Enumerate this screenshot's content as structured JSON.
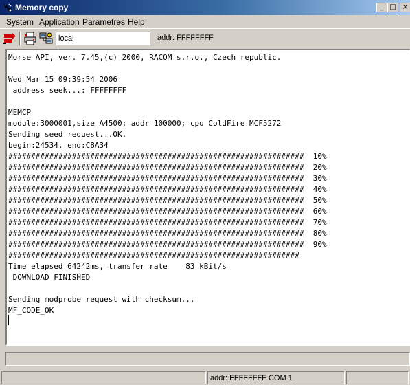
{
  "window": {
    "title": "Memory copy",
    "buttons": {
      "minimize": "_",
      "maximize": "□",
      "close": "×"
    }
  },
  "menu": {
    "items": [
      "System",
      "Application",
      "Parametres",
      "Help"
    ]
  },
  "toolbar": {
    "icons": [
      "exit-icon",
      "print-icon",
      "network-settings-icon"
    ],
    "host_value": "local",
    "addr_text": "addr: FFFFFFFF"
  },
  "terminal": {
    "lines": [
      "Morse API, ver. 7.45,(c) 2000, RACOM s.r.o., Czech republic.",
      "",
      "Wed Mar 15 09:39:54 2006",
      " address seek...: FFFFFFFF",
      "",
      "MEMCP",
      "module:3000001,size A4500; addr 100000; cpu ColdFire MCF5272",
      "Sending seed request...OK.",
      "begin:24534, end:C8A34",
      "#################################################################  10%",
      "#################################################################  20%",
      "#################################################################  30%",
      "#################################################################  40%",
      "#################################################################  50%",
      "#################################################################  60%",
      "#################################################################  70%",
      "#################################################################  80%",
      "#################################################################  90%",
      "################################################################",
      "Time elapsed 64242ms, transfer rate    83 kBit/s",
      " DOWNLOAD FINISHED",
      "",
      "Sending modprobe request with checksum...",
      "MF_CODE_OK"
    ]
  },
  "status": {
    "panes": [
      "",
      "addr: FFFFFFFF  COM 1",
      ""
    ]
  },
  "colors": {
    "title_gradient_start": "#0a246a",
    "title_gradient_end": "#a6caf0",
    "face": "#d4d0c8",
    "exit_icon_red": "#d40000"
  }
}
